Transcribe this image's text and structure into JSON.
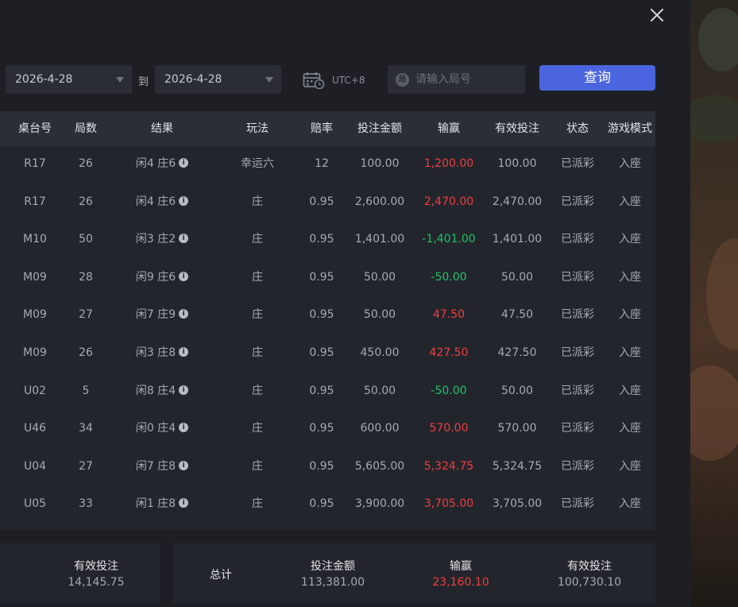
{
  "filters": {
    "start_date": "2026-4-28",
    "to_label": "到",
    "end_date": "2026-4-28",
    "timezone": "UTC+8",
    "round_placeholder": "请输入局号",
    "round_icon_char": "局",
    "query_label": "查询"
  },
  "table": {
    "headers": [
      "桌台号",
      "局数",
      "结果",
      "玩法",
      "赔率",
      "投注金额",
      "输赢",
      "有效投注",
      "状态",
      "游戏模式"
    ],
    "rows": [
      {
        "table": "R17",
        "round": "26",
        "result": "闲4 庄6",
        "play": "幸运六",
        "odds": "12",
        "bet": "100.00",
        "win": "1,200.00",
        "win_sign": "pos",
        "valid": "100.00",
        "status": "已派彩",
        "mode": "入座"
      },
      {
        "table": "R17",
        "round": "26",
        "result": "闲4 庄6",
        "play": "庄",
        "odds": "0.95",
        "bet": "2,600.00",
        "win": "2,470.00",
        "win_sign": "pos",
        "valid": "2,470.00",
        "status": "已派彩",
        "mode": "入座"
      },
      {
        "table": "M10",
        "round": "50",
        "result": "闲3 庄2",
        "play": "庄",
        "odds": "0.95",
        "bet": "1,401.00",
        "win": "-1,401.00",
        "win_sign": "neg",
        "valid": "1,401.00",
        "status": "已派彩",
        "mode": "入座"
      },
      {
        "table": "M09",
        "round": "28",
        "result": "闲9 庄6",
        "play": "庄",
        "odds": "0.95",
        "bet": "50.00",
        "win": "-50.00",
        "win_sign": "neg",
        "valid": "50.00",
        "status": "已派彩",
        "mode": "入座"
      },
      {
        "table": "M09",
        "round": "27",
        "result": "闲7 庄9",
        "play": "庄",
        "odds": "0.95",
        "bet": "50.00",
        "win": "47.50",
        "win_sign": "pos",
        "valid": "47.50",
        "status": "已派彩",
        "mode": "入座"
      },
      {
        "table": "M09",
        "round": "26",
        "result": "闲3 庄8",
        "play": "庄",
        "odds": "0.95",
        "bet": "450.00",
        "win": "427.50",
        "win_sign": "pos",
        "valid": "427.50",
        "status": "已派彩",
        "mode": "入座"
      },
      {
        "table": "U02",
        "round": "5",
        "result": "闲8 庄4",
        "play": "庄",
        "odds": "0.95",
        "bet": "50.00",
        "win": "-50.00",
        "win_sign": "neg",
        "valid": "50.00",
        "status": "已派彩",
        "mode": "入座"
      },
      {
        "table": "U46",
        "round": "34",
        "result": "闲0 庄4",
        "play": "庄",
        "odds": "0.95",
        "bet": "600.00",
        "win": "570.00",
        "win_sign": "pos",
        "valid": "570.00",
        "status": "已派彩",
        "mode": "入座"
      },
      {
        "table": "U04",
        "round": "27",
        "result": "闲7 庄8",
        "play": "庄",
        "odds": "0.95",
        "bet": "5,605.00",
        "win": "5,324.75",
        "win_sign": "pos",
        "valid": "5,324.75",
        "status": "已派彩",
        "mode": "入座"
      },
      {
        "table": "U05",
        "round": "33",
        "result": "闲1 庄8",
        "play": "庄",
        "odds": "0.95",
        "bet": "3,900.00",
        "win": "3,705.00",
        "win_sign": "pos",
        "valid": "3,705.00",
        "status": "已派彩",
        "mode": "入座"
      }
    ]
  },
  "summary_left": {
    "valid_label": "有效投注",
    "valid_value": "14,145.75"
  },
  "summary_total": {
    "total_label": "总计",
    "bet_label": "投注金额",
    "bet_value": "113,381.00",
    "win_label": "输赢",
    "win_value": "23,160.10",
    "valid_label": "有效投注",
    "valid_value": "100,730.10"
  },
  "colors": {
    "accent": "#4a65df",
    "positive": "#ef3e40",
    "negative": "#1ec46a"
  },
  "icons": {
    "close": "close-icon",
    "caret": "caret-down-icon",
    "calendar": "calendar-clock-icon",
    "info": "info-icon"
  }
}
